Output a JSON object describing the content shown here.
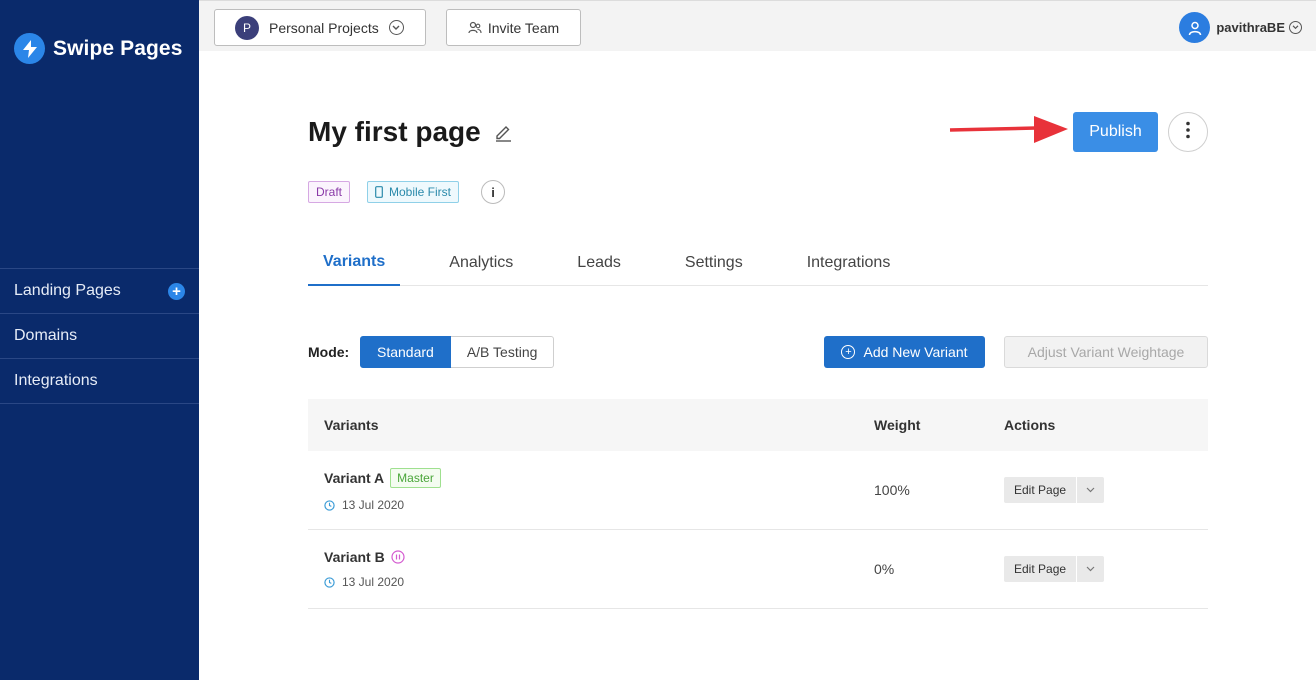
{
  "brand": {
    "name": "Swipe Pages"
  },
  "sidebar": {
    "items": [
      {
        "label": "Landing Pages",
        "has_add": true
      },
      {
        "label": "Domains"
      },
      {
        "label": "Integrations"
      }
    ]
  },
  "topbar": {
    "project": {
      "initial": "P",
      "label": "Personal Projects"
    },
    "invite_label": "Invite Team",
    "user_name": "pavithraBE"
  },
  "page": {
    "title": "My first page",
    "publish_label": "Publish",
    "badges": {
      "draft": "Draft",
      "mobile": "Mobile First"
    },
    "info_symbol": "i"
  },
  "tabs": [
    {
      "label": "Variants",
      "active": true
    },
    {
      "label": "Analytics"
    },
    {
      "label": "Leads"
    },
    {
      "label": "Settings"
    },
    {
      "label": "Integrations"
    }
  ],
  "mode": {
    "label": "Mode:",
    "options": [
      "Standard",
      "A/B Testing"
    ],
    "selected": "Standard"
  },
  "actions": {
    "add_variant": "Add New Variant",
    "adjust_weight": "Adjust Variant Weightage"
  },
  "table": {
    "headers": {
      "variants": "Variants",
      "weight": "Weight",
      "actions": "Actions"
    },
    "rows": [
      {
        "name": "Variant A",
        "badge": "Master",
        "date": "13 Jul 2020",
        "weight": "100%",
        "action": "Edit Page"
      },
      {
        "name": "Variant B",
        "paused": true,
        "date": "13 Jul 2020",
        "weight": "0%",
        "action": "Edit Page"
      }
    ]
  },
  "colors": {
    "sidebar_bg": "#0a2a6b",
    "primary": "#1f6fc9",
    "publish": "#3a8ee6",
    "arrow": "#e8323a"
  },
  "icons": {
    "brand": "lightning-bolt-icon",
    "edit": "pencil-icon",
    "more": "vertical-dots-icon",
    "user": "user-icon",
    "clock": "clock-icon",
    "pause": "pause-circle-icon"
  }
}
